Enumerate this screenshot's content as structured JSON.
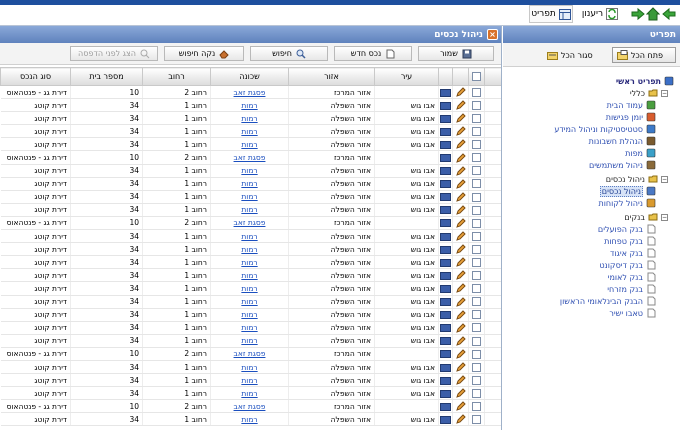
{
  "topbar": {
    "refresh_label": "ריענון",
    "menu_label": "תפריט"
  },
  "left_panel": {
    "title": "ניהול נכסים",
    "toolbar": {
      "save_label": "שמור",
      "new_asset_label": "נכס חדש",
      "search_label": "חיפוש",
      "clear_search_label": "נקה חיפוש",
      "print_preview_label": "הצג לפני הדפסה"
    },
    "columns": {
      "city": "עיר",
      "area": "אזור",
      "neighborhood": "שכונה",
      "street": "רחוב",
      "house_number": "מספר בית",
      "asset_type": "סוג הנכס"
    },
    "rows": [
      {
        "city": "",
        "area": "אזור המרכז",
        "neighborhood": "פסגת זאב",
        "street": "רחוב 2",
        "house_number": "10",
        "asset_type": "דירת גג - פנטהאוס"
      },
      {
        "city": "אבו גוש",
        "area": "אזור השפלה",
        "neighborhood": "רמות",
        "street": "רחוב 1",
        "house_number": "34",
        "asset_type": "דירת קוטג"
      },
      {
        "city": "אבו גוש",
        "area": "אזור השפלה",
        "neighborhood": "רמות",
        "street": "רחוב 1",
        "house_number": "34",
        "asset_type": "דירת קוטג"
      },
      {
        "city": "אבו גוש",
        "area": "אזור השפלה",
        "neighborhood": "רמות",
        "street": "רחוב 1",
        "house_number": "34",
        "asset_type": "דירת קוטג"
      },
      {
        "city": "אבו גוש",
        "area": "אזור השפלה",
        "neighborhood": "רמות",
        "street": "רחוב 1",
        "house_number": "34",
        "asset_type": "דירת קוטג"
      },
      {
        "city": "",
        "area": "אזור המרכז",
        "neighborhood": "פסגת זאב",
        "street": "רחוב 2",
        "house_number": "10",
        "asset_type": "דירת גג - פנטהאוס"
      },
      {
        "city": "אבו גוש",
        "area": "אזור השפלה",
        "neighborhood": "רמות",
        "street": "רחוב 1",
        "house_number": "34",
        "asset_type": "דירת קוטג"
      },
      {
        "city": "אבו גוש",
        "area": "אזור השפלה",
        "neighborhood": "רמות",
        "street": "רחוב 1",
        "house_number": "34",
        "asset_type": "דירת קוטג"
      },
      {
        "city": "אבו גוש",
        "area": "אזור השפלה",
        "neighborhood": "רמות",
        "street": "רחוב 1",
        "house_number": "34",
        "asset_type": "דירת קוטג"
      },
      {
        "city": "אבו גוש",
        "area": "אזור השפלה",
        "neighborhood": "רמות",
        "street": "רחוב 1",
        "house_number": "34",
        "asset_type": "דירת קוטג"
      },
      {
        "city": "",
        "area": "אזור המרכז",
        "neighborhood": "פסגת זאב",
        "street": "רחוב 2",
        "house_number": "10",
        "asset_type": "דירת גג - פנטהאוס"
      },
      {
        "city": "אבו גוש",
        "area": "אזור השפלה",
        "neighborhood": "רמות",
        "street": "רחוב 1",
        "house_number": "34",
        "asset_type": "דירת קוטג"
      },
      {
        "city": "אבו גוש",
        "area": "אזור השפלה",
        "neighborhood": "רמות",
        "street": "רחוב 1",
        "house_number": "34",
        "asset_type": "דירת קוטג"
      },
      {
        "city": "אבו גוש",
        "area": "אזור השפלה",
        "neighborhood": "רמות",
        "street": "רחוב 1",
        "house_number": "34",
        "asset_type": "דירת קוטג"
      },
      {
        "city": "אבו גוש",
        "area": "אזור השפלה",
        "neighborhood": "רמות",
        "street": "רחוב 1",
        "house_number": "34",
        "asset_type": "דירת קוטג"
      },
      {
        "city": "אבו גוש",
        "area": "אזור השפלה",
        "neighborhood": "רמות",
        "street": "רחוב 1",
        "house_number": "34",
        "asset_type": "דירת קוטג"
      },
      {
        "city": "אבו גוש",
        "area": "אזור השפלה",
        "neighborhood": "רמות",
        "street": "רחוב 1",
        "house_number": "34",
        "asset_type": "דירת קוטג"
      },
      {
        "city": "אבו גוש",
        "area": "אזור השפלה",
        "neighborhood": "רמות",
        "street": "רחוב 1",
        "house_number": "34",
        "asset_type": "דירת קוטג"
      },
      {
        "city": "אבו גוש",
        "area": "אזור השפלה",
        "neighborhood": "רמות",
        "street": "רחוב 1",
        "house_number": "34",
        "asset_type": "דירת קוטג"
      },
      {
        "city": "אבו גוש",
        "area": "אזור השפלה",
        "neighborhood": "רמות",
        "street": "רחוב 1",
        "house_number": "34",
        "asset_type": "דירת קוטג"
      },
      {
        "city": "",
        "area": "אזור המרכז",
        "neighborhood": "פסגת זאב",
        "street": "רחוב 2",
        "house_number": "10",
        "asset_type": "דירת גג - פנטהאוס"
      },
      {
        "city": "אבו גוש",
        "area": "אזור השפלה",
        "neighborhood": "רמות",
        "street": "רחוב 1",
        "house_number": "34",
        "asset_type": "דירת קוטג"
      },
      {
        "city": "אבו גוש",
        "area": "אזור השפלה",
        "neighborhood": "רמות",
        "street": "רחוב 1",
        "house_number": "34",
        "asset_type": "דירת קוטג"
      },
      {
        "city": "אבו גוש",
        "area": "אזור השפלה",
        "neighborhood": "רמות",
        "street": "רחוב 1",
        "house_number": "34",
        "asset_type": "דירת קוטג"
      },
      {
        "city": "",
        "area": "אזור המרכז",
        "neighborhood": "פסגת זאב",
        "street": "רחוב 2",
        "house_number": "10",
        "asset_type": "דירת גג - פנטהאוס"
      },
      {
        "city": "אבו גוש",
        "area": "אזור השפלה",
        "neighborhood": "רמות",
        "street": "רחוב 1",
        "house_number": "34",
        "asset_type": "דירת קוטג"
      }
    ]
  },
  "right_panel": {
    "title": "תפריט",
    "open_all_label": "פתח הכל",
    "close_all_label": "סגור הכל",
    "tree": [
      {
        "label": "תפריט ראשי",
        "icon": "home-icon",
        "style": "bold"
      },
      {
        "label": "כללי",
        "icon": "folder-icon",
        "style": "plain"
      },
      {
        "label": "עמוד הבית",
        "icon": "house-icon",
        "style": "link"
      },
      {
        "label": "יומן פגישות",
        "icon": "calendar-icon",
        "style": "link"
      },
      {
        "label": "סטטיסטיקות וניהול המידע",
        "icon": "stats-icon",
        "style": "link"
      },
      {
        "label": "הנהלת חשבונות",
        "icon": "accounting-icon",
        "style": "link"
      },
      {
        "label": "מפות",
        "icon": "map-icon",
        "style": "link"
      },
      {
        "label": "ניהול משתמשים",
        "icon": "users-icon",
        "style": "link"
      },
      {
        "label": "ניהול נכסים",
        "icon": "assets-icon",
        "style": "plain"
      },
      {
        "label": "ניהול נכסים",
        "icon": "assets-list-icon",
        "style": "selected"
      },
      {
        "label": "ניהול לקוחות",
        "icon": "customers-icon",
        "style": "link"
      },
      {
        "label": "בנקים",
        "icon": "folder-icon",
        "style": "plain"
      },
      {
        "label": "בנק הפועלים",
        "icon": "page-icon",
        "style": "link"
      },
      {
        "label": "בנק טפחות",
        "icon": "page-icon",
        "style": "link"
      },
      {
        "label": "בנק איגוד",
        "icon": "page-icon",
        "style": "link"
      },
      {
        "label": "בנק דיסקונט",
        "icon": "page-icon",
        "style": "link"
      },
      {
        "label": "בנק לאומי",
        "icon": "page-icon",
        "style": "link"
      },
      {
        "label": "בנק מזרחי",
        "icon": "page-icon",
        "style": "link"
      },
      {
        "label": "הבנק הבינלאומי הראשון",
        "icon": "page-icon",
        "style": "link"
      },
      {
        "label": "טאבו ישיר",
        "icon": "page-icon",
        "style": "link"
      }
    ]
  }
}
